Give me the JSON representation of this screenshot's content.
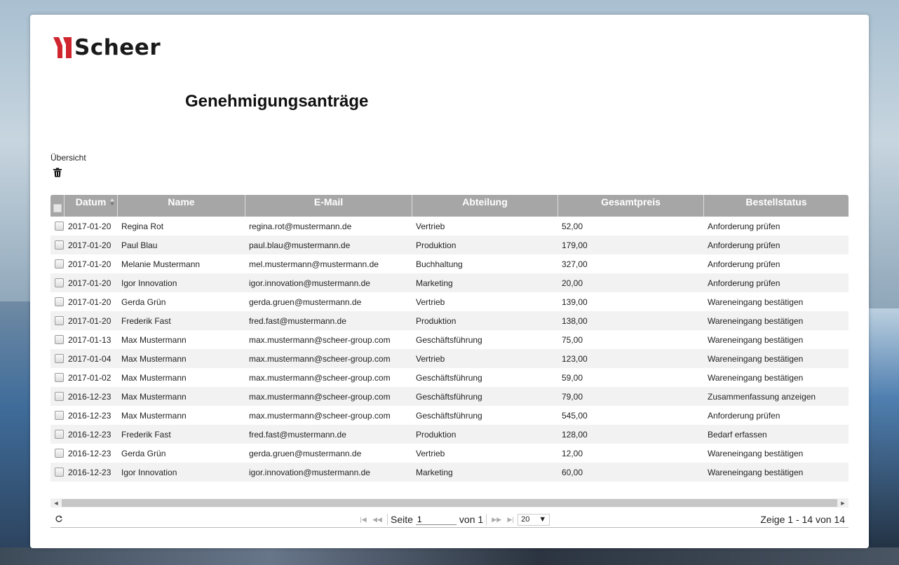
{
  "brand": {
    "logo_text": "Scheer",
    "accent_color": "#d0252f"
  },
  "page": {
    "title": "Genehmigungsanträge",
    "section_label": "Übersicht"
  },
  "toolbar": {
    "delete_icon": "trash-icon"
  },
  "grid": {
    "columns": [
      "Datum",
      "Name",
      "E-Mail",
      "Abteilung",
      "Gesamtpreis",
      "Bestellstatus"
    ],
    "sort_column": "Datum",
    "rows": [
      [
        "2017-01-20",
        "Regina Rot",
        "regina.rot@mustermann.de",
        "Vertrieb",
        "52,00",
        "Anforderung prüfen"
      ],
      [
        "2017-01-20",
        "Paul Blau",
        "paul.blau@mustermann.de",
        "Produktion",
        "179,00",
        "Anforderung prüfen"
      ],
      [
        "2017-01-20",
        "Melanie Mustermann",
        "mel.mustermann@mustermann.de",
        "Buchhaltung",
        "327,00",
        "Anforderung prüfen"
      ],
      [
        "2017-01-20",
        "Igor Innovation",
        "igor.innovation@mustermann.de",
        "Marketing",
        "20,00",
        "Anforderung prüfen"
      ],
      [
        "2017-01-20",
        "Gerda Grün",
        "gerda.gruen@mustermann.de",
        "Vertrieb",
        "139,00",
        "Wareneingang bestätigen"
      ],
      [
        "2017-01-20",
        "Frederik Fast",
        "fred.fast@mustermann.de",
        "Produktion",
        "138,00",
        "Wareneingang bestätigen"
      ],
      [
        "2017-01-13",
        "Max Mustermann",
        "max.mustermann@scheer-group.com",
        "Geschäftsführung",
        "75,00",
        "Wareneingang bestätigen"
      ],
      [
        "2017-01-04",
        "Max Mustermann",
        "max.mustermann@scheer-group.com",
        "Vertrieb",
        "123,00",
        "Wareneingang bestätigen"
      ],
      [
        "2017-01-02",
        "Max Mustermann",
        "max.mustermann@scheer-group.com",
        "Geschäftsführung",
        "59,00",
        "Wareneingang bestätigen"
      ],
      [
        "2016-12-23",
        "Max Mustermann",
        "max.mustermann@scheer-group.com",
        "Geschäftsführung",
        "79,00",
        "Zusammenfassung anzeigen"
      ],
      [
        "2016-12-23",
        "Max Mustermann",
        "max.mustermann@scheer-group.com",
        "Geschäftsführung",
        "545,00",
        "Anforderung prüfen"
      ],
      [
        "2016-12-23",
        "Frederik Fast",
        "fred.fast@mustermann.de",
        "Produktion",
        "128,00",
        "Bedarf erfassen"
      ],
      [
        "2016-12-23",
        "Gerda Grün",
        "gerda.gruen@mustermann.de",
        "Vertrieb",
        "12,00",
        "Wareneingang bestätigen"
      ],
      [
        "2016-12-23",
        "Igor Innovation",
        "igor.innovation@mustermann.de",
        "Marketing",
        "60,00",
        "Wareneingang bestätigen"
      ]
    ]
  },
  "pager": {
    "page_label": "Seite",
    "page_value": "1",
    "of_label": "von 1",
    "page_size": "20",
    "info": "Zeige 1 - 14 von 14"
  }
}
